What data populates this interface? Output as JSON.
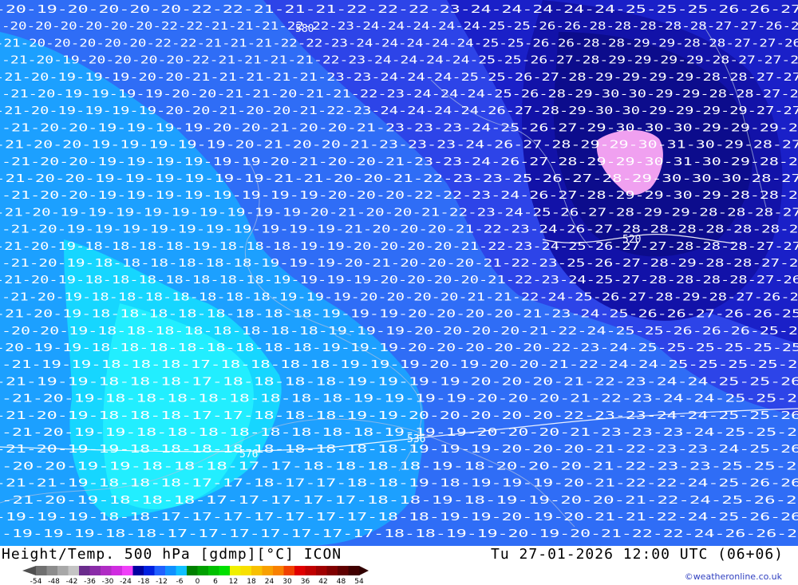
{
  "map": {
    "title": "Height/Temp. 500 hPa [gdmp][°C] ICON",
    "valid_time": "Tu 27-01-2026 12:00 UTC (06+06)",
    "credit": "©weatheronline.co.uk",
    "height_contour_labels": [
      "576",
      "580",
      "536",
      "520"
    ],
    "temperature_rows": [
      "-20-19-20-20-20-20-22-22-21-21-21-22-22-22-23-24-24-24-24-24-25-25-25-26-26-27",
      "-20-20-20-20-20-20-22-22-21-21-21-22-22-23-24-24-24-24-24-25-25-26-26-28-28-28-28-28-27-27-26-27",
      "-21-20-20-20-20-20-22-22-21-21-21-22-22-23-24-24-24-24-24-25-25-26-26-28-28-29-29-28-28-27-27-26",
      "-21-20-19-20-20-20-20-22-21-21-21-21-22-23-24-24-24-24-25-25-26-27-28-29-29-29-29-28-27-27-26",
      "-21-20-19-19-19-20-20-21-21-21-21-21-23-23-24-24-24-25-25-26-27-28-29-29-29-29-28-28-27-27",
      "-21-20-19-19-19-19-20-20-21-21-20-21-21-22-23-24-24-24-25-26-28-29-30-30-29-29-28-28-27-27",
      "-21-20-19-19-19-19-20-20-21-20-20-21-22-23-24-24-24-24-26-27-28-29-30-30-29-29-29-29-27-27",
      "-21-20-20-19-19-19-19-20-20-21-20-20-21-23-23-23-24-25-26-27-29-30-30-30-29-29-29-28",
      "-21-20-20-19-19-19-19-19-20-21-20-20-21-23-23-23-24-26-27-28-29-29-30-31-30-29-28-27",
      "-21-20-20-19-19-19-19-19-19-20-21-20-20-21-23-23-24-26-27-28-29-29-30-31-30-29-28-27",
      "-21-20-20-19-19-19-19-19-19-21-21-20-20-21-22-23-23-25-26-27-28-29-30-30-30-28-27",
      "-21-20-20-19-19-19-19-19-19-19-19-20-20-20-22-22-23-24-26-27-28-29-29-30-29-28-28-27",
      "-21-20-19-19-19-19-19-19-19-19-19-20-21-20-20-21-22-23-24-25-26-27-28-29-29-28-28-28-27",
      "-21-20-19-19-19-19-19-19-19-19-19-19-21-20-20-20-21-22-23-24-26-27-28-28-28-28-28-28-27",
      "-21-20-19-18-18-18-18-19-18-18-18-19-19-20-20-20-20-21-22-23-24-25-26-27-27-28-28-28-27-27",
      "-21-20-19-18-18-18-18-18-18-19-19-19-20-21-20-20-20-21-22-23-25-26-27-28-29-28-28-27-27",
      "-21-20-19-18-18-18-18-18-18-18-19-19-19-19-20-20-20-20-21-22-23-24-25-27-28-28-28-28-27-26",
      "-21-20-19-18-18-18-18-18-18-18-19-19-19-20-20-20-20-21-21-22-24-25-26-27-28-29-28-27-26-26",
      "-21-20-19-18-18-18-18-18-18-18-18-19-19-19-20-20-20-20-21-23-24-25-26-26-27-26-26-25",
      "-20-20-19-18-18-18-18-18-18-18-18-19-19-19-20-20-20-20-21-22-24-25-25-26-26-26-25-25",
      "-20-19-19-18-18-18-18-18-18-18-18-19-19-19-20-20-20-20-20-22-23-24-25-25-25-25-25-25",
      "-21-19-19-18-18-18-17-18-18-18-18-19-19-19-20-19-20-20-21-22-24-24-25-25-25-25-25",
      "-21-19-19-18-18-18-17-18-18-18-18-19-19-19-19-20-20-20-21-22-23-24-24-25-25-26",
      "-21-20-19-18-18-18-18-18-18-18-18-19-19-19-19-20-20-20-21-22-23-24-24-25-25-26",
      "-21-20-19-18-18-18-17-17-18-18-18-19-19-20-20-20-20-20-22-23-23-24-24-25-25-26",
      "-21-20-19-19-18-18-18-18-18-18-18-18-19-19-19-20-20-20-21-23-23-23-24-25-25-26",
      "-21-20-19-19-18-18-18-18-18-18-18-18-18-19-19-19-20-20-20-21-22-23-23-24-25-26",
      "-20-20-19-19-18-18-18-17-17-18-18-18-18-19-18-20-20-20-21-22-23-23-25-25-26",
      "-21-21-19-18-18-18-17-17-18-17-17-18-18-19-18-19-19-19-20-21-22-22-24-25-26-26",
      "-21-20-19-18-18-18-17-17-17-17-17-18-18-19-18-19-19-20-20-21-22-24-25-26-26",
      "-19-19-19-18-18-17-17-17-17-17-17-17-18-18-19-19-20-19-20-21-21-22-24-25-26-26",
      "-19-19-19-18-18-17-17-17-17-17-17-17-18-18-19-19-20-19-20-21-22-22-24-26-26-26"
    ]
  },
  "legend": {
    "tick_labels": [
      "-54",
      "-48",
      "-42",
      "-36",
      "-30",
      "-24",
      "-18",
      "-12",
      "-6",
      "0",
      "6",
      "12",
      "18",
      "24",
      "30",
      "36",
      "42",
      "48",
      "54"
    ],
    "colors": [
      "#707070",
      "#8c8c8c",
      "#a8a8a8",
      "#c4c4c4",
      "#6a2c8c",
      "#8a2ca8",
      "#b02cc4",
      "#d02ce0",
      "#f040f8",
      "#0000a0",
      "#0020e0",
      "#2060ff",
      "#1090ff",
      "#10c0ff",
      "#008000",
      "#00a000",
      "#00c000",
      "#00e000",
      "#f0f000",
      "#f8e000",
      "#f8c000",
      "#f8a000",
      "#f88000",
      "#f04000",
      "#e00000",
      "#c00000",
      "#a00000",
      "#800000",
      "#600000",
      "#400000"
    ]
  }
}
